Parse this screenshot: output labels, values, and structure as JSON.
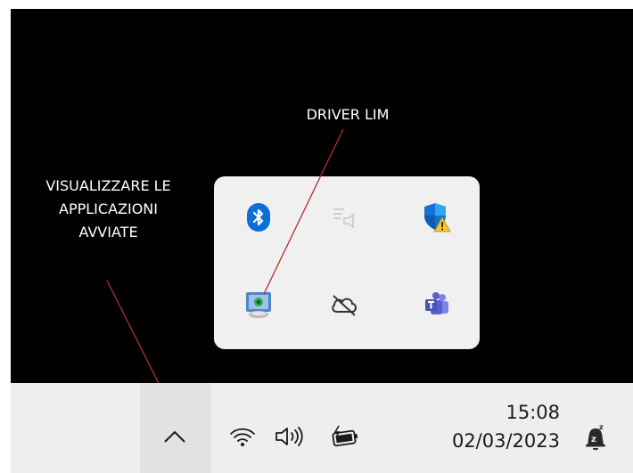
{
  "annotations": {
    "driver_label": "DRIVER LIM",
    "apps_label_lines": [
      "VISUALIZZARE LE",
      "APPLICAZIONI",
      "AVVIATE"
    ]
  },
  "tray_flyout": {
    "icons": [
      "bluetooth-icon",
      "audio-output-icon",
      "windows-security-warning-icon",
      "lim-driver-icon",
      "onedrive-offline-icon",
      "teams-icon"
    ]
  },
  "taskbar": {
    "clock": {
      "time": "15:08",
      "date": "02/03/2023"
    },
    "icons": [
      "show-hidden-icons-chevron",
      "wifi-icon",
      "volume-icon",
      "battery-charging-icon",
      "notification-focus-icon"
    ]
  },
  "colors": {
    "screen_background": "#000000",
    "annotation_text": "#ffffff",
    "leader_line": "#b03030",
    "flyout_background": "#f0f0f0",
    "taskbar_background": "#eeeeee",
    "bluetooth_blue": "#0a6fd8",
    "teams_purple": "#5b5fc7"
  }
}
